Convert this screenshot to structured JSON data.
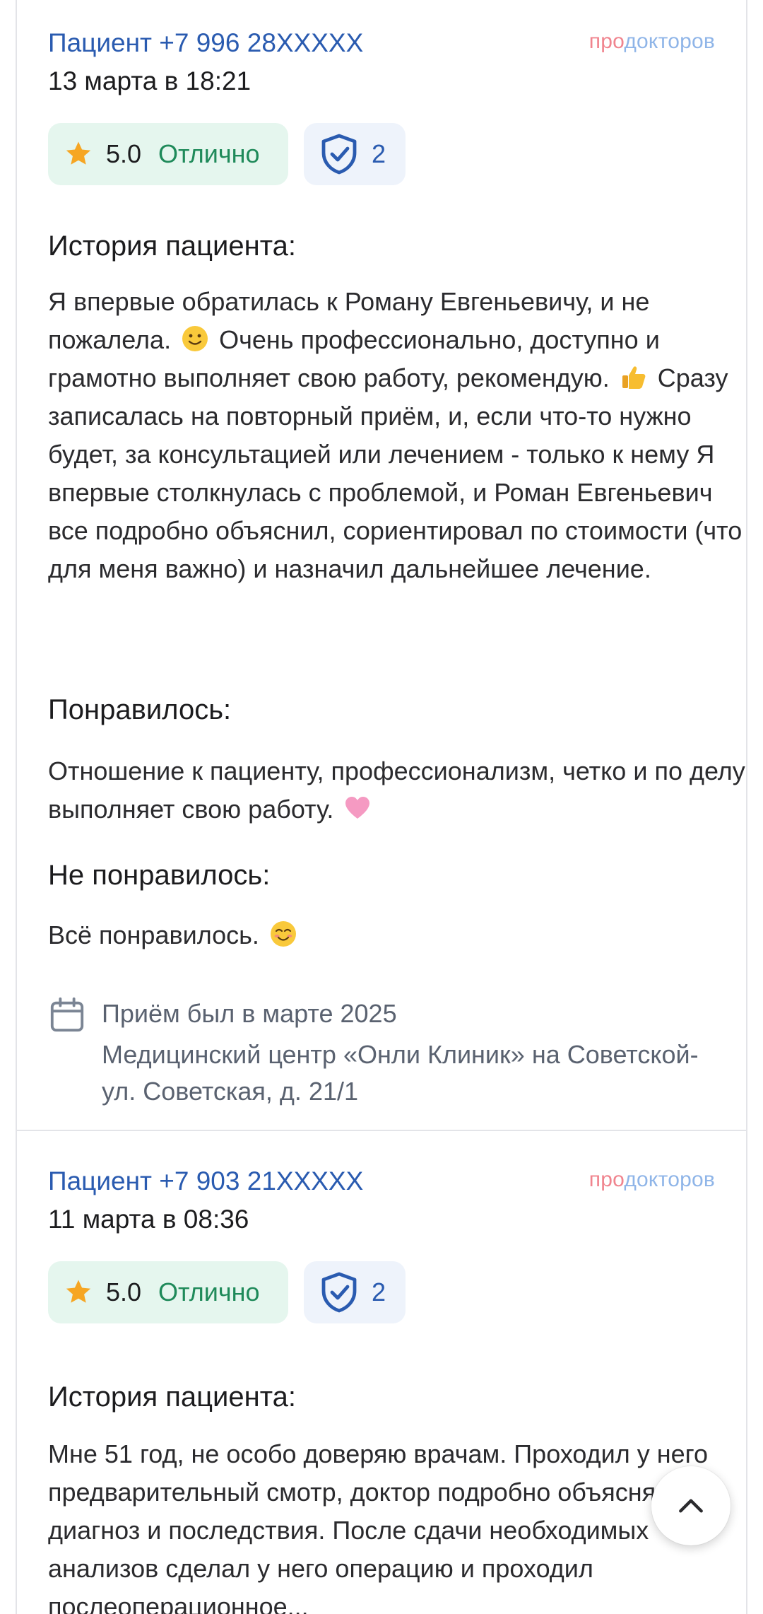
{
  "brand_logo": {
    "pro": "про",
    "doc": "докторов"
  },
  "reviews": [
    {
      "author": "Пациент +7 996 28XXXXX",
      "date": "13 марта в 18:21",
      "rating": "5.0",
      "rating_word": "Отлично",
      "verified_count": "2",
      "story_title": "История пациента:",
      "story_parts": [
        "Я впервые обратилась к Роману Евгеньевичу, и не пожалела. ",
        " Очень профессионально, доступно и грамотно выполняет свою работу, рекомендую. ",
        " Сразу записалась на повторный приём, и, если что-то нужно будет, за консультацией или лечением - только к нему Я впервые столкнулась с проблемой, и Роман Евгеньевич все подробно объяснил, сориентировал по стоимости (что для меня важно) и назначил дальнейшее лечение."
      ],
      "liked_title": "Понравилось:",
      "liked_text": "Отношение к пациенту, профессионализм, четко и по делу выполняет свою работу. ",
      "disliked_title": "Не понравилось:",
      "disliked_text": "Всё понравилось. ",
      "visit_date": "Приём был в марте 2025",
      "visit_place": "Медицинский центр «Онли Клиник» на Советской-ул. Советская, д. 21/1"
    },
    {
      "author": "Пациент +7 903 21XXXXX",
      "date": "11 марта в 08:36",
      "rating": "5.0",
      "rating_word": "Отлично",
      "verified_count": "2",
      "story_title": "История пациента:",
      "story_text": "Мне 51 год, не особо доверяю врачам. Проходил у него предварительный смотр, доктор подробно объясняет диагноз и последствия. После сдачи необходимых анализов сделал у него операцию и проходил послеоперационное..."
    }
  ],
  "colors": {
    "link": "#2a5bb0",
    "rating_bg": "#e5f6ee",
    "rating_text": "#1f8a5a",
    "shield_bg": "#eef3fb"
  },
  "icons": [
    "star-icon",
    "shield-check-icon",
    "calendar-icon",
    "chevron-up-icon",
    "smile-emoji",
    "thumbs-up-emoji",
    "pink-heart-emoji",
    "blush-emoji"
  ]
}
